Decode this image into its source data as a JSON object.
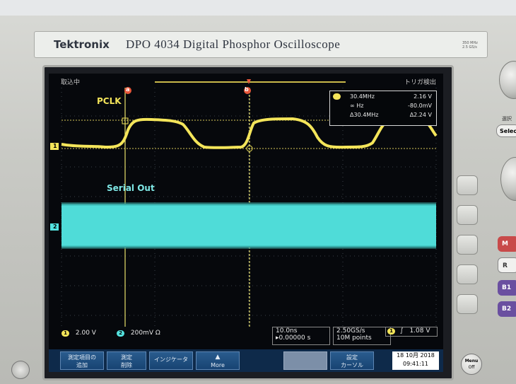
{
  "instrument": {
    "brand": "Tektronix",
    "model": "DPO 4034",
    "description": "Digital Phosphor Oscilloscope",
    "spec_line1": "350 MHz",
    "spec_line2": "2.5 GS/s"
  },
  "screen": {
    "status_left": "取込中",
    "status_right": "トリガ検出",
    "trigger_marker": "T",
    "cursor_a_marker": "a",
    "cursor_b_marker": "b",
    "ch1_marker": "1",
    "ch2_marker": "2",
    "ch1_label": "PCLK",
    "ch2_label": "Serial Out",
    "colors": {
      "ch1": "#f2e35a",
      "ch2": "#54e3e0",
      "cursor_a": "#e8573a"
    }
  },
  "measurements": {
    "row1": {
      "left": "30.4MHz",
      "right": "2.16 V"
    },
    "row2": {
      "left": "∞ Hz",
      "right": "-80.0mV"
    },
    "row3": {
      "left": "Δ30.4MHz",
      "right": "Δ2.24 V"
    }
  },
  "bottom": {
    "ch1_scale": "2.00 V",
    "ch2_scale": "200mV Ω",
    "ch1_num": "1",
    "ch2_num": "2",
    "timebase": "10.0ns",
    "delay": "▸0.00000 s",
    "sample_rate": "2.50GS/s",
    "record_length": "10M points",
    "trig_channel": "1",
    "trig_slope": "∫",
    "trig_level": "1.08 V"
  },
  "softkeys": {
    "k1_line1": "測定項目の",
    "k1_line2": "追加",
    "k2_line1": "測定",
    "k2_line2": "削除",
    "k3": "インジケータ",
    "k4": "More",
    "k5_line1": "",
    "k5_line2": "",
    "k6_line1": "設定",
    "k6_line2": "カーソル"
  },
  "datetime": {
    "date": "18 10月 2018",
    "time": "09:41:11"
  },
  "panel": {
    "select_label": "選択",
    "select_button": "Select",
    "menu_label": "Menu",
    "off_label": "Off",
    "btn_m": "M",
    "btn_r": "R",
    "btn_b1": "B1",
    "btn_b2": "B2"
  }
}
